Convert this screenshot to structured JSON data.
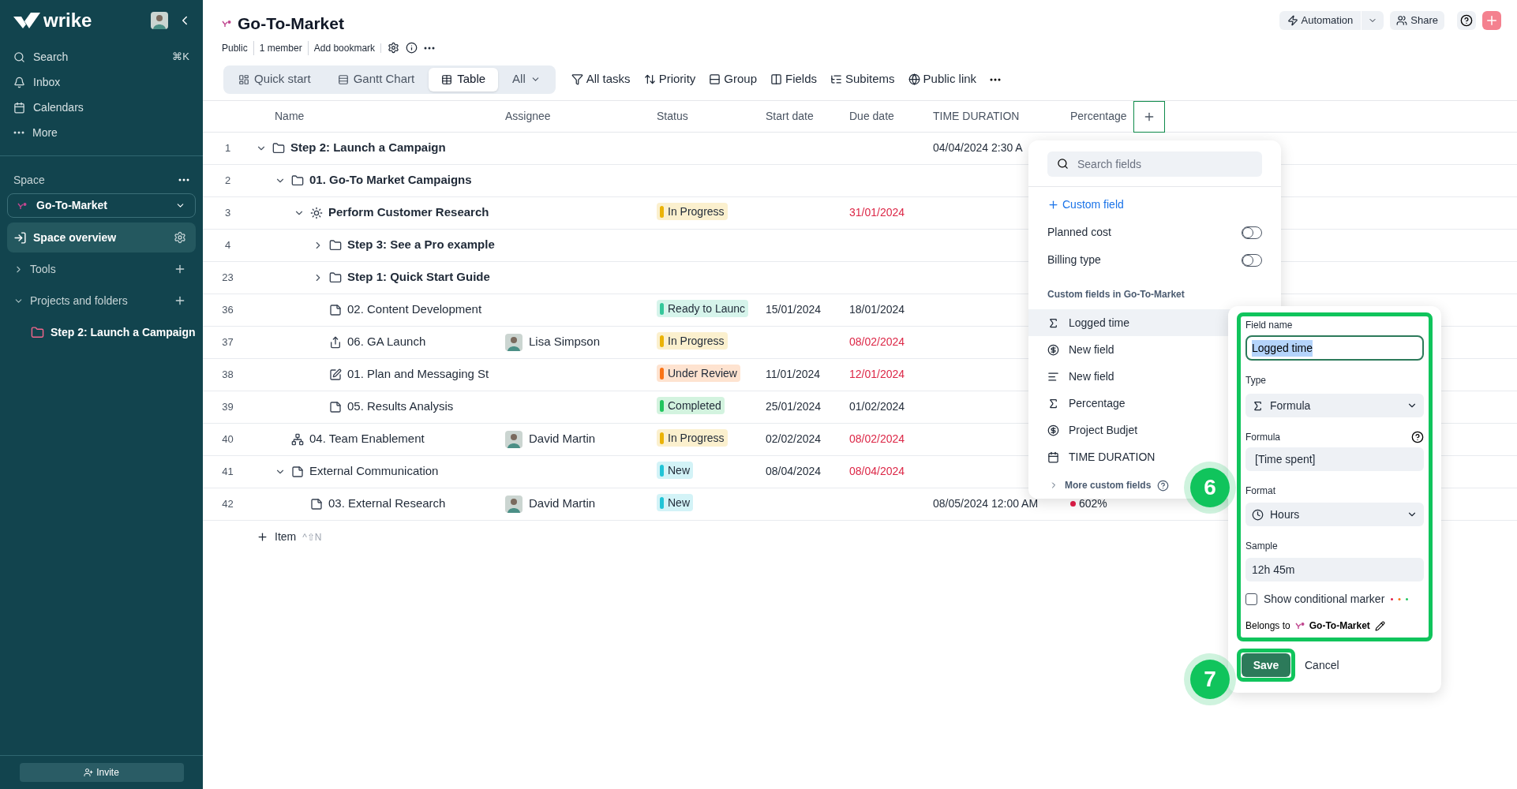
{
  "sidebar": {
    "logo": "wrike",
    "nav": [
      {
        "kind": "search",
        "label": "Search",
        "shortcut": "⌘K"
      },
      {
        "kind": "inbox",
        "label": "Inbox"
      },
      {
        "kind": "calendar",
        "label": "Calendars"
      },
      {
        "kind": "more",
        "label": "More"
      }
    ],
    "space_label": "Space",
    "space_selector": "Go-To-Market",
    "items": [
      {
        "kind": "overview",
        "label": "Space overview",
        "selected": true
      },
      {
        "kind": "section",
        "label": "Tools",
        "expanded": false
      },
      {
        "kind": "section",
        "label": "Projects and folders",
        "expanded": true,
        "children": [
          {
            "kind": "folder",
            "label": "Step 2: Launch a Campaign",
            "expanded": false
          }
        ]
      }
    ],
    "invite": "Invite"
  },
  "header": {
    "title": "Go-To-Market",
    "meta": [
      "Public",
      "1 member",
      "Add bookmark"
    ],
    "automation": "Automation",
    "share": "Share"
  },
  "views": [
    {
      "label": "Quick start",
      "kind": "start",
      "selected": false
    },
    {
      "label": "Gantt Chart",
      "kind": "gantt",
      "selected": false
    },
    {
      "label": "Table",
      "kind": "table",
      "selected": true
    },
    {
      "label": "All",
      "kind": "menu",
      "selected": false
    }
  ],
  "actions": [
    {
      "kind": "filter",
      "label": "All tasks"
    },
    {
      "kind": "sort",
      "label": "Priority"
    },
    {
      "kind": "group",
      "label": "Group"
    },
    {
      "kind": "fields",
      "label": "Fields"
    },
    {
      "kind": "subitems",
      "label": "Subitems"
    },
    {
      "kind": "globe",
      "label": "Public link"
    }
  ],
  "table": {
    "columns": [
      "Name",
      "Assignee",
      "Status",
      "Start date",
      "Due date",
      "TIME DURATION",
      "Percentage"
    ],
    "rows": [
      {
        "num": "1",
        "kind": "folder",
        "name": "Step 2: Launch a Campaign",
        "expanded": true,
        "time": "04/04/2024 2:30 A",
        "children": [
          {
            "num": "2",
            "kind": "folder",
            "name": "01. Go-To Market Campaigns",
            "expanded": true,
            "children": [
              {
                "num": "3",
                "kind": "project",
                "name": "Perform Customer Research",
                "expanded": true,
                "status": {
                  "label": "In Progress",
                  "color": "#eab308"
                },
                "due": "31/01/2024",
                "overdue": true,
                "children": [
                  {
                    "num": "4",
                    "kind": "folder",
                    "name": "Step 3: See a Pro example",
                    "expanded": false
                  },
                  {
                    "num": "23",
                    "kind": "folder",
                    "name": "Step 1: Quick Start Guide",
                    "expanded": false
                  },
                  {
                    "num": "36",
                    "kind": "task",
                    "name": "02. Content Development",
                    "status": {
                      "label": "Ready to Launc",
                      "color": "#34c79a"
                    },
                    "start": "15/01/2024",
                    "due": "18/01/2024",
                    "overdue": false
                  },
                  {
                    "num": "37",
                    "kind": "launch",
                    "name": "06. GA Launch",
                    "assignee": "Lisa Simpson",
                    "status": {
                      "label": "In Progress",
                      "color": "#eab308"
                    },
                    "due": "08/02/2024",
                    "overdue": true
                  },
                  {
                    "num": "38",
                    "kind": "review",
                    "name": "01. Plan and Messaging St",
                    "status": {
                      "label": "Under Review",
                      "color": "#f97316"
                    },
                    "start": "11/01/2024",
                    "due": "12/01/2024",
                    "overdue": true
                  },
                  {
                    "num": "39",
                    "kind": "task",
                    "name": "05. Results Analysis",
                    "status": {
                      "label": "Completed",
                      "color": "#22c55e"
                    },
                    "start": "25/01/2024",
                    "due": "01/02/2024",
                    "overdue": false
                  }
                ]
              }
            ]
          },
          {
            "num": "40",
            "kind": "team",
            "name": "04. Team Enablement",
            "assignee": "David Martin",
            "status": {
              "label": "In Progress",
              "color": "#eab308"
            },
            "start": "02/02/2024",
            "due": "08/02/2024",
            "overdue": true
          },
          {
            "num": "41",
            "kind": "task",
            "name": "External Communication",
            "expanded": true,
            "status": {
              "label": "New",
              "color": "#22c4d6"
            },
            "start": "08/04/2024",
            "due": "08/04/2024",
            "overdue": true,
            "children": [
              {
                "num": "42",
                "kind": "task",
                "name": "03. External Research",
                "assignee": "David Martin",
                "status": {
                  "label": "New",
                  "color": "#22c4d6"
                },
                "time": "08/05/2024 12:00 AM",
                "percent": {
                  "text": "602%",
                  "color": "#e11d48"
                }
              }
            ]
          }
        ]
      }
    ],
    "add_item": "Item",
    "add_item_shortcut": "^⇧N"
  },
  "fields_menu": {
    "placeholder": "Search fields",
    "custom_field": "Custom field",
    "toggles": [
      {
        "label": "Planned cost",
        "on": false
      },
      {
        "label": "Billing type",
        "on": false
      }
    ],
    "section": "Custom fields in Go-To-Market",
    "items": [
      {
        "kind": "formula",
        "label": "Logged time",
        "selected": true
      },
      {
        "kind": "currency",
        "label": "New field",
        "selected": false
      },
      {
        "kind": "text",
        "label": "New field",
        "selected": false
      },
      {
        "kind": "formula",
        "label": "Percentage",
        "selected": false
      },
      {
        "kind": "currency",
        "label": "Project Budjet",
        "selected": false
      },
      {
        "kind": "date",
        "label": "TIME DURATION",
        "selected": false
      }
    ],
    "more": "More custom fields"
  },
  "field_editor": {
    "name_label": "Field name",
    "name_value": "Logged time",
    "type_label": "Type",
    "type_value": "Formula",
    "formula_label": "Formula",
    "formula_value": "[Time spent]",
    "format_label": "Format",
    "format_value": "Hours",
    "sample_label": "Sample",
    "sample_value": "12h 45m",
    "marker_label": "Show conditional marker",
    "marker_checked": false,
    "belongs_label": "Belongs to",
    "belongs_value": "Go-To-Market",
    "save": "Save",
    "cancel": "Cancel"
  },
  "callouts": [
    {
      "label": "6"
    },
    {
      "label": "7"
    }
  ]
}
